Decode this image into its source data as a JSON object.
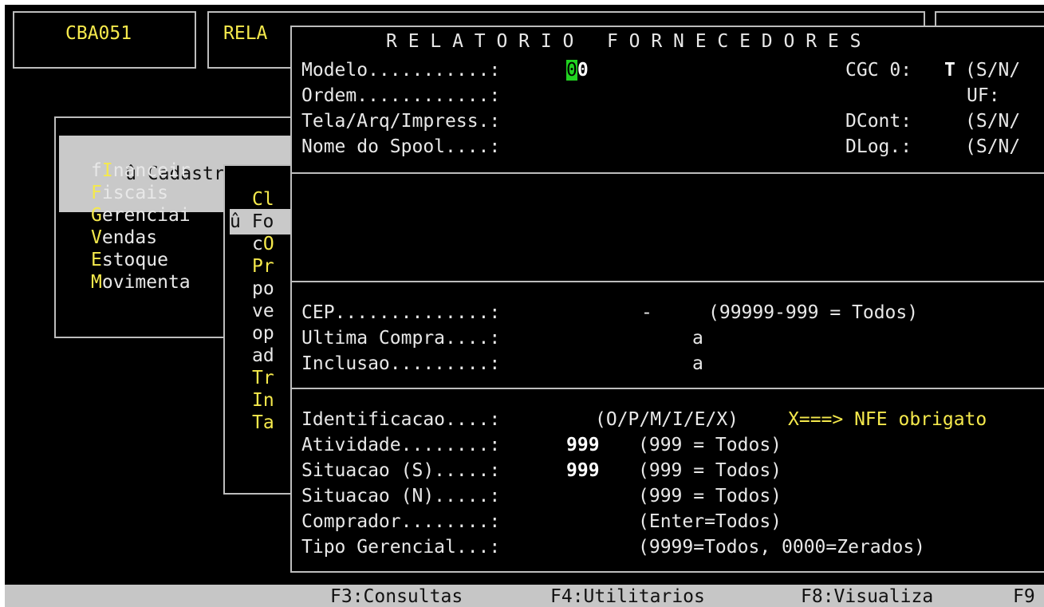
{
  "top_tabs": [
    "CBA051",
    "RELA"
  ],
  "main_menu": {
    "items": [
      {
        "hot": "û ",
        "rest": "Cadastros",
        "selected": true
      },
      {
        "pre": "f",
        "hot": "I",
        "rest": "nanceir"
      },
      {
        "hot": "F",
        "rest": "iscais"
      },
      {
        "hot": "G",
        "rest": "erenciai"
      },
      {
        "hot": "V",
        "rest": "endas"
      },
      {
        "hot": "E",
        "rest": "stoque"
      },
      {
        "hot": "M",
        "rest": "ovimenta"
      }
    ]
  },
  "sub_menu": {
    "items": [
      {
        "pre": "",
        "hot": "Cl",
        "rest": ""
      },
      {
        "pre": "û ",
        "hot": "Fo",
        "rest": "",
        "selected": true
      },
      {
        "pre": "c",
        "hot": "O",
        "rest": ""
      },
      {
        "pre": "",
        "hot": "Pr",
        "rest": ""
      },
      {
        "pre": "po",
        "hot": "",
        "rest": ""
      },
      {
        "pre": "ve",
        "hot": "",
        "rest": ""
      },
      {
        "pre": "op",
        "hot": "",
        "rest": ""
      },
      {
        "pre": "ad",
        "hot": "",
        "rest": ""
      },
      {
        "pre": "",
        "hot": "Tr",
        "rest": ""
      },
      {
        "pre": "",
        "hot": "In",
        "rest": ""
      },
      {
        "pre": "",
        "hot": "Ta",
        "rest": ""
      }
    ]
  },
  "dialog": {
    "title": "R E L A T O R I O   F O R N E C E D O R E S",
    "section1": {
      "modelo_label": "Modelo...........:",
      "modelo_cursor": "0",
      "modelo_value": "0",
      "ordem_label": "Ordem............:",
      "tela_label": "Tela/Arq/Impress.:",
      "spool_label": "Nome do Spool....:",
      "cgc_label": "CGC 0:",
      "cgc_value": "T",
      "cgc_hint": "(S/N/",
      "uf_label": "UF:",
      "dcont_label": "DCont:",
      "dcont_hint": "(S/N/",
      "dlog_label": "DLog.:",
      "dlog_hint": "(S/N/"
    },
    "section3": {
      "cep_label": "CEP..............:",
      "cep_dash": "-",
      "cep_hint": "(99999-999 = Todos)",
      "ultima_label": "Ultima Compra....:",
      "ultima_a": "a",
      "inclusao_label": "Inclusao.........:",
      "inclusao_a": "a"
    },
    "section4": {
      "ident_label": "Identificacao....:",
      "ident_hint": "(O/P/M/I/E/X)",
      "ident_note": "X===> NFE obrigato",
      "ativ_label": "Atividade........:",
      "ativ_value": "999",
      "ativ_hint": "(999 = Todos)",
      "sits_label": "Situacao (S).....:",
      "sits_value": "999",
      "sits_hint": "(999 = Todos)",
      "sitn_label": "Situacao (N).....:",
      "sitn_hint": "(999 = Todos)",
      "comp_label": "Comprador........:",
      "comp_hint": "(Enter=Todos)",
      "tipo_label": "Tipo Gerencial...:",
      "tipo_hint": "(9999=Todos, 0000=Zerados)"
    }
  },
  "status_bar": [
    "F3:Consultas",
    "F4:Utilitarios",
    "F8:Visualiza",
    "F9"
  ]
}
